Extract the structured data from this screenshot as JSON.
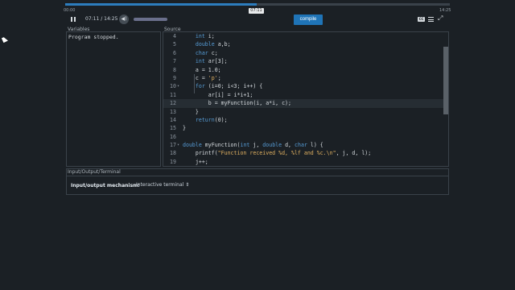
{
  "player": {
    "start_time": "00:00",
    "end_time": "14:25",
    "tooltip_time": "07:11",
    "time_display": "07:11 / 14:25",
    "progress_fraction": 0.4985,
    "compile_label": "compile",
    "cc_label": "CC"
  },
  "variables": {
    "title": "Variables",
    "output": "Program stopped."
  },
  "source": {
    "title": "Source",
    "lines": [
      {
        "n": "4",
        "fold": "",
        "html": "    <span class=\"kw\">int</span> i;"
      },
      {
        "n": "5",
        "fold": "",
        "html": "    <span class=\"kw\">double</span> a,b;"
      },
      {
        "n": "6",
        "fold": "",
        "html": "    <span class=\"kw\">char</span> c;"
      },
      {
        "n": "7",
        "fold": "",
        "html": "    <span class=\"kw\">int</span> ar[3];"
      },
      {
        "n": "8",
        "fold": "",
        "html": "    a = 1.0;"
      },
      {
        "n": "9",
        "fold": "",
        "html": "    c = <span class=\"str\">'p'</span>;"
      },
      {
        "n": "10",
        "fold": "▾",
        "html": "    <span class=\"kw\">for</span> (i=0; i<3; i++) {"
      },
      {
        "n": "11",
        "fold": "",
        "html": "        ar[i] = i*i+1;"
      },
      {
        "n": "12",
        "fold": "",
        "html": "        b = myFunction(i, a*i, c);",
        "active": true
      },
      {
        "n": "13",
        "fold": "",
        "html": "    }"
      },
      {
        "n": "14",
        "fold": "",
        "html": "    <span class=\"kw\">return</span>(0);"
      },
      {
        "n": "15",
        "fold": "",
        "html": "}"
      },
      {
        "n": "16",
        "fold": "",
        "html": ""
      },
      {
        "n": "17",
        "fold": "▾",
        "html": "<span class=\"kw\">double</span> myFunction(<span class=\"kw\">int</span> j, <span class=\"kw\">double</span> d, <span class=\"kw\">char</span> l) {"
      },
      {
        "n": "18",
        "fold": "",
        "html": "    printf(<span class=\"str\">\"Function received %d, %lf and %c.\\n\"</span>, j, d, l);"
      },
      {
        "n": "19",
        "fold": "",
        "html": "    j++;"
      }
    ]
  },
  "io": {
    "title": "Input/Output/Terminal",
    "mechanism_label": "Input/output mechanism:",
    "mechanism_value": "Interactive terminal ⇕"
  }
}
